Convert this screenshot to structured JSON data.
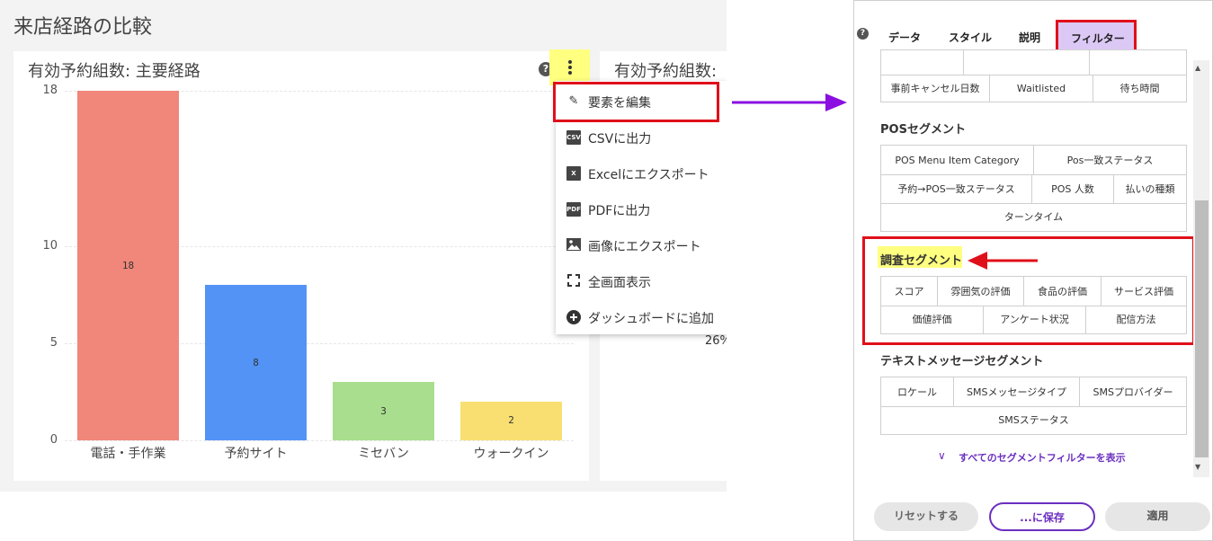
{
  "dashboard": {
    "title": "来店経路の比較",
    "card1_title": "有効予約組数: 主要経路",
    "card2_title": "有効予約組数:",
    "card2_value": "26%"
  },
  "chart_data": {
    "type": "bar",
    "categories": [
      "電話・手作業",
      "予約サイト",
      "ミセバン",
      "ウォークイン"
    ],
    "values": [
      18,
      8,
      3,
      2
    ],
    "data_labels": [
      "18",
      "8",
      "3",
      "2"
    ],
    "colors": [
      "#f0877a",
      "#5393f5",
      "#a8de8e",
      "#f9df72"
    ],
    "y_ticks": [
      "0",
      "5",
      "10",
      "18"
    ],
    "ylim": [
      0,
      18
    ],
    "title": "",
    "xlabel": "",
    "ylabel": ""
  },
  "menu": {
    "items": [
      {
        "label": "要素を編集",
        "icon": "edit-icon"
      },
      {
        "label": "CSVに出力",
        "icon": "csv-file-icon",
        "icon_text": "CSV"
      },
      {
        "label": "Excelにエクスポート",
        "icon": "excel-file-icon",
        "icon_text": "X"
      },
      {
        "label": "PDFに出力",
        "icon": "pdf-file-icon",
        "icon_text": "PDF"
      },
      {
        "label": "画像にエクスポート",
        "icon": "image-icon"
      },
      {
        "label": "全画面表示",
        "icon": "fullscreen-icon"
      },
      {
        "label": "ダッシュボードに追加",
        "icon": "add-circle-icon"
      }
    ]
  },
  "panel": {
    "tabs": [
      "データ",
      "スタイル",
      "説明",
      "フィルター"
    ],
    "active_tab": "フィルター",
    "top_rows": [
      [
        "",
        "",
        ""
      ],
      [
        "事前キャンセル日数",
        "Waitlisted",
        "待ち時間"
      ]
    ],
    "pos": {
      "title": "POSセグメント",
      "rows": [
        [
          "POS Menu Item Category",
          "Pos一致ステータス"
        ],
        [
          "予約→POS一致ステータス",
          "POS 人数",
          "払いの種類"
        ],
        [
          "ターンタイム"
        ]
      ]
    },
    "survey": {
      "title": "調査セグメント",
      "rows": [
        [
          "スコア",
          "雰囲気の評価",
          "食品の評価",
          "サービス評価"
        ],
        [
          "価値評価",
          "アンケート状況",
          "配信方法"
        ]
      ]
    },
    "sms": {
      "title": "テキストメッセージセグメント",
      "rows": [
        [
          "ロケール",
          "SMSメッセージタイプ",
          "SMSプロバイダー"
        ],
        [
          "SMSステータス"
        ]
      ]
    },
    "show_all": "すべてのセグメントフィルターを表示",
    "buttons": {
      "reset": "リセットする",
      "save": "...に保存",
      "apply": "適用"
    }
  },
  "accent_color": "#6b2fc0",
  "highlight_color": "#e0101a"
}
